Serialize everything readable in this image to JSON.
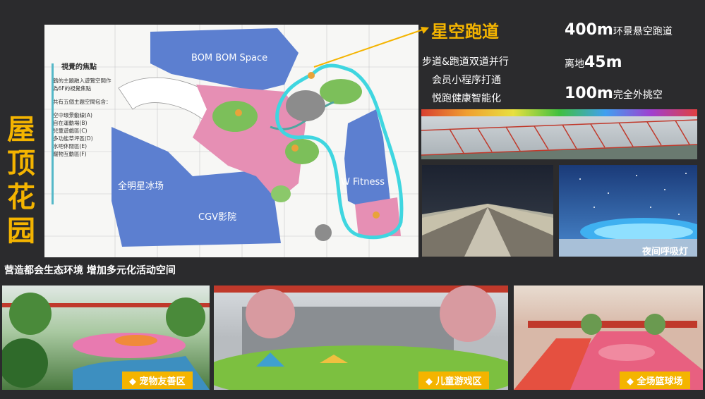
{
  "vertical_title": [
    "屋",
    "顶",
    "花",
    "园"
  ],
  "plan": {
    "legend_title": "視覺的焦點",
    "legend_desc": "鶴的主題融入遊覽空間作為6F的視覺焦點",
    "legend_count": "共有五個主題空間包含：",
    "legend_items": [
      "空中環景動線(A)",
      "自在運動場(B)",
      "兒童遊戲區(C)",
      "多功能草坪區(D)",
      "水吧休閒區(E)",
      "寵物互動區(F)"
    ],
    "labels": {
      "bom": "BOM BOM Space",
      "mingxing": "全明星冰场",
      "cgv": "CGV影院",
      "fitness": "W Fitness"
    }
  },
  "subtitle": "营造都会生态环境   增加多元化活动空间",
  "track_title": "星空跑道",
  "features": [
    "步道&跑道双道并行",
    "会员小程序打通",
    "悦跑健康智能化"
  ],
  "stats": [
    {
      "big": "400m",
      "rest": "环景悬空跑道"
    },
    {
      "pre": "离地",
      "big": "45m"
    },
    {
      "big": "100m",
      "rest": "完全外挑空"
    }
  ],
  "night_label": "夜间呼吸灯",
  "tags": [
    "宠物友善区",
    "儿童游戏区",
    "全场篮球场"
  ],
  "colors": {
    "accent": "#f4b400",
    "track": "#3fd6e0",
    "background": "#2b2b2d"
  }
}
